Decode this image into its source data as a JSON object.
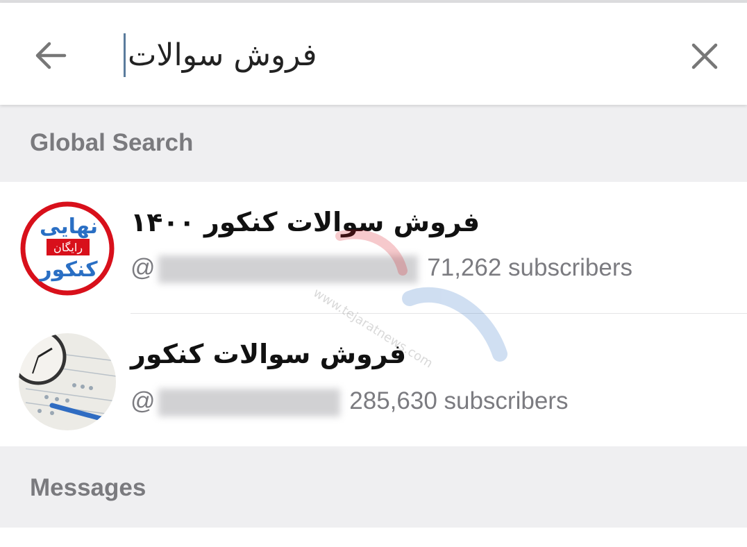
{
  "search": {
    "query": "فروش سوالات"
  },
  "icons": {
    "back": "arrow-left-icon",
    "clear": "close-icon"
  },
  "sections": {
    "global": "Global Search",
    "messages": "Messages"
  },
  "results": [
    {
      "title": "فروش سوالات کنکور ۱۴۰۰",
      "username_prefix": "@",
      "subscribers": "71,262 subscribers",
      "avatar": {
        "line1": "نهایی",
        "line2": "رایگان",
        "line3": "کنکور"
      }
    },
    {
      "title": "فروش سوالات کنکور",
      "username_prefix": "@",
      "subscribers": "285,630 subscribers"
    }
  ],
  "watermark": {
    "url": "www.tejaratnews.com"
  },
  "colors": {
    "accent": "#5a7b9c",
    "section_bg": "#efeff1",
    "avatar_ring": "#d8101b"
  }
}
